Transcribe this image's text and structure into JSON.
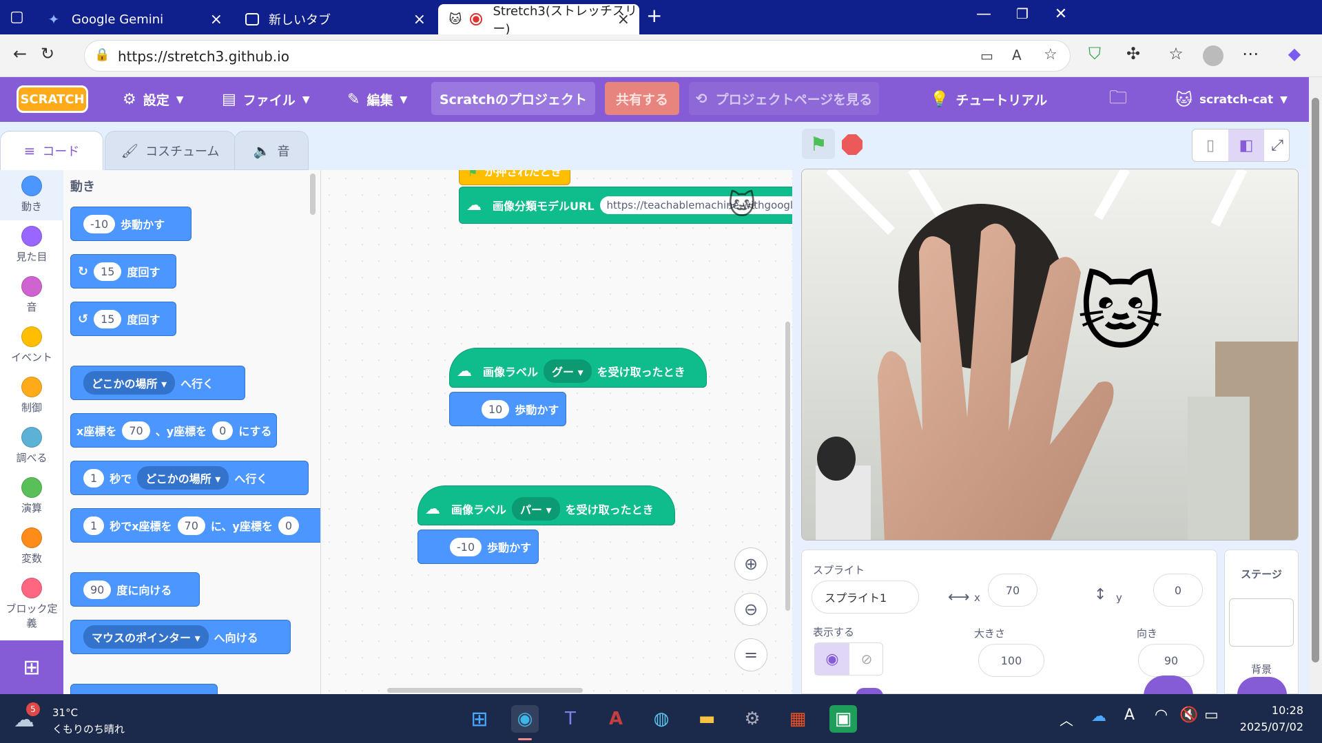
{
  "browser": {
    "tabs": [
      {
        "title": "Google Gemini",
        "icon": "gemini-icon"
      },
      {
        "title": "新しいタブ",
        "icon": "newtab-icon"
      },
      {
        "title": "Stretch3(ストレッチスリー)",
        "icon": "recording-icon"
      }
    ],
    "url": "https://stretch3.github.io"
  },
  "menu": {
    "settings": "設定",
    "file": "ファイル",
    "edit": "編集",
    "project_title": "Scratchのプロジェクト",
    "share": "共有する",
    "see_project_page": "プロジェクトページを見る",
    "tutorials": "チュートリアル",
    "username": "scratch-cat",
    "logo": "SCRATCH"
  },
  "editor_tabs": {
    "code": "コード",
    "costumes": "コスチューム",
    "sounds": "音"
  },
  "categories": [
    {
      "label": "動き",
      "color": "#4c97ff"
    },
    {
      "label": "見た目",
      "color": "#9966ff"
    },
    {
      "label": "音",
      "color": "#cf63cf"
    },
    {
      "label": "イベント",
      "color": "#ffbf00"
    },
    {
      "label": "制御",
      "color": "#ffab19"
    },
    {
      "label": "調べる",
      "color": "#5cb1d6"
    },
    {
      "label": "演算",
      "color": "#59c059"
    },
    {
      "label": "変数",
      "color": "#ff8c1a"
    },
    {
      "label": "ブロック定義",
      "color": "#ff6680"
    }
  ],
  "palette": {
    "heading": "動き",
    "move": {
      "value": "-10",
      "label": "歩動かす"
    },
    "turn_right": {
      "value": "15",
      "label": "度回す"
    },
    "turn_left": {
      "value": "15",
      "label": "度回す"
    },
    "goto": {
      "option": "どこかの場所",
      "label": "へ行く"
    },
    "goto_xy": {
      "xlabel": "x座標を",
      "x": "70",
      "ylabel": "、y座標を",
      "y": "0",
      "suffix": "にする"
    },
    "glide": {
      "secs": "1",
      "mid": "秒で",
      "option": "どこかの場所",
      "suffix": "へ行く"
    },
    "glide_xy": {
      "secs": "1",
      "mid": "秒でx座標を",
      "x": "70",
      "ylabel": "に、y座標を",
      "y": "0"
    },
    "point_dir": {
      "value": "90",
      "label": "度に向ける"
    },
    "point_towards": {
      "option": "マウスのポインター",
      "label": "へ向ける"
    }
  },
  "scripts": {
    "flag_hat": "が押されたとき",
    "model_url_label": "画像分類モデルURL",
    "model_url": "https://teachablemachine.withgoogl",
    "hat1": {
      "label": "画像ラベル",
      "option": "グー",
      "suffix": "を受け取ったとき"
    },
    "move1": {
      "value": "10",
      "label": "歩動かす"
    },
    "hat2": {
      "label": "画像ラベル",
      "option": "パー",
      "suffix": "を受け取ったとき"
    },
    "move2": {
      "value": "-10",
      "label": "歩動かす"
    }
  },
  "sprite_info": {
    "sprite_label": "スプライト",
    "sprite_name": "スプライト1",
    "x_label": "x",
    "x": "70",
    "y_label": "y",
    "y": "0",
    "show_label": "表示する",
    "size_label": "大きさ",
    "size": "100",
    "direction_label": "向き",
    "direction": "90"
  },
  "stage_pane": {
    "title": "ステージ",
    "backdrop": "背景"
  },
  "taskbar": {
    "weather_badge": "5",
    "temperature": "31°C",
    "condition": "くもりのち晴れ",
    "time": "10:28",
    "date": "2025/07/02"
  },
  "colors": {
    "scratch_purple": "#855cd6",
    "motion_blue": "#4c97ff",
    "ml_green": "#0fbd8c",
    "event_yellow": "#ffbf00"
  }
}
